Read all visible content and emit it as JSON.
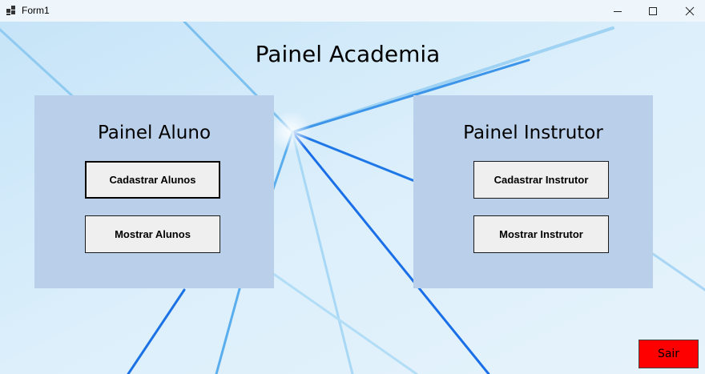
{
  "window": {
    "title": "Form1"
  },
  "main": {
    "title": "Painel Academia"
  },
  "panels": {
    "aluno": {
      "title": "Painel Aluno",
      "register_button": "Cadastrar Alunos",
      "show_button": "Mostrar Alunos"
    },
    "instrutor": {
      "title": "Painel Instrutor",
      "register_button": "Cadastrar Instrutor",
      "show_button": "Mostrar Instrutor"
    }
  },
  "footer": {
    "exit_button": "Sair"
  },
  "colors": {
    "panel_bg": "#bad0ea",
    "exit_bg": "#ff0000",
    "wallpaper_light": "#dbeefa",
    "wallpaper_blue": "#1a6fe8"
  },
  "icons": {
    "app": "app-icon",
    "minimize": "minimize-icon",
    "maximize": "maximize-icon",
    "close": "close-icon"
  }
}
